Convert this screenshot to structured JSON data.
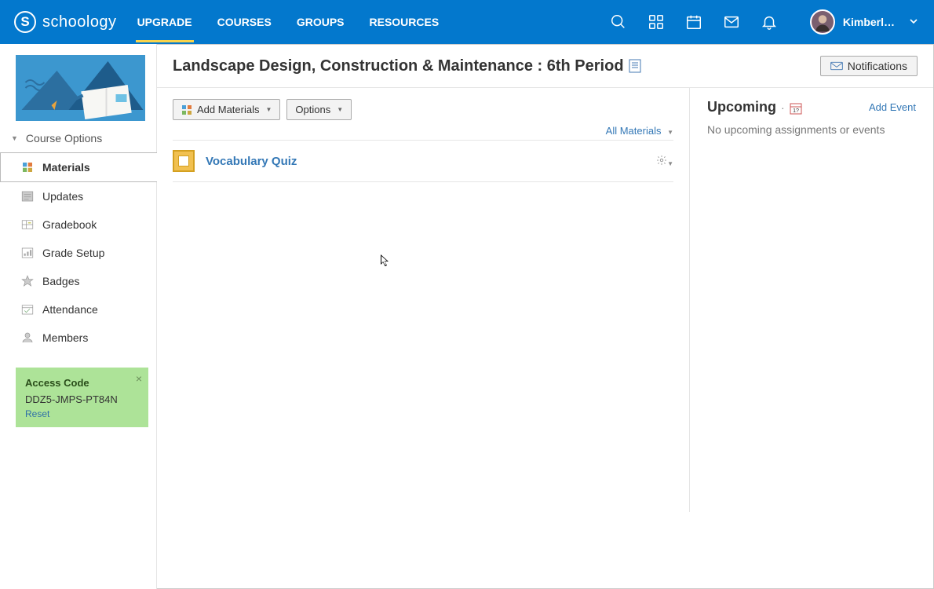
{
  "brand": "schoology",
  "nav": {
    "links": [
      "UPGRADE",
      "COURSES",
      "GROUPS",
      "RESOURCES"
    ],
    "active_index": 0,
    "user_display": "Kimberl…"
  },
  "sidebar": {
    "course_options": "Course Options",
    "items": [
      {
        "label": "Materials"
      },
      {
        "label": "Updates"
      },
      {
        "label": "Gradebook"
      },
      {
        "label": "Grade Setup"
      },
      {
        "label": "Badges"
      },
      {
        "label": "Attendance"
      },
      {
        "label": "Members"
      }
    ],
    "active_index": 0,
    "access": {
      "title": "Access Code",
      "code": "DDZ5-JMPS-PT84N",
      "reset": "Reset"
    }
  },
  "page": {
    "title": "Landscape Design, Construction & Maintenance : 6th Period",
    "notifications_btn": "Notifications"
  },
  "toolbar": {
    "add_materials": "Add Materials",
    "options": "Options",
    "filter": "All Materials"
  },
  "materials": [
    {
      "title": "Vocabulary Quiz"
    }
  ],
  "upcoming": {
    "title": "Upcoming",
    "add_event": "Add Event",
    "empty": "No upcoming assignments or events"
  }
}
